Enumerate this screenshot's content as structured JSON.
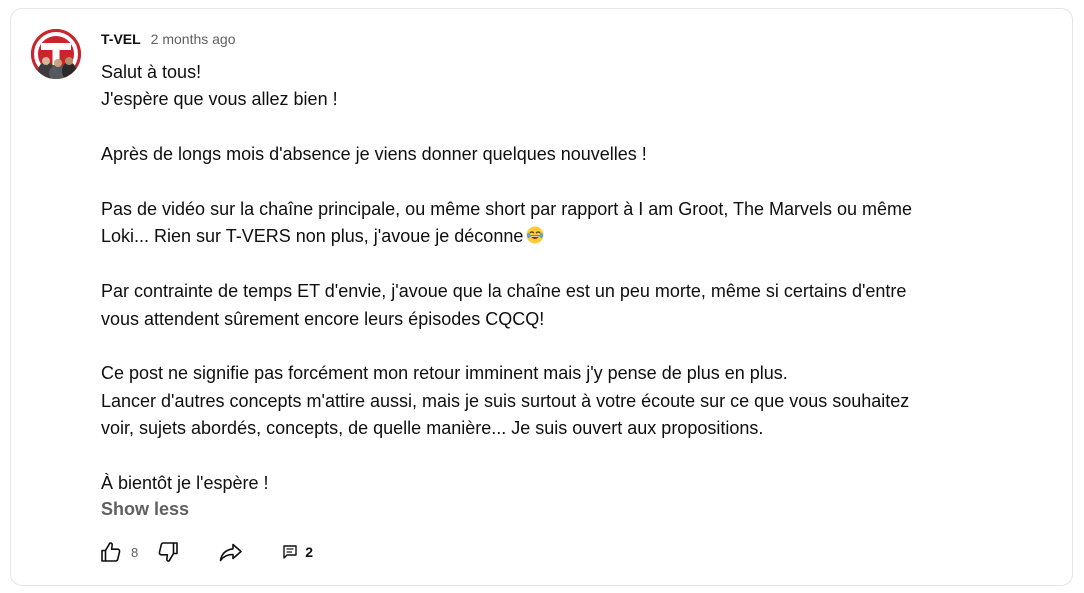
{
  "post": {
    "author": "T-VEL",
    "timestamp": "2 months ago",
    "paragraphs": [
      [
        "Salut à tous!",
        "J'espère que vous allez bien !"
      ],
      [
        "Après de longs mois d'absence je viens donner quelques nouvelles !"
      ],
      [
        "Pas de vidéo sur la chaîne principale, ou même short par rapport à I am Groot, The Marvels ou même",
        "Loki... Rien sur T-VERS non plus, j'avoue je déconne"
      ],
      [
        "Par contrainte de temps ET d'envie, j'avoue que la chaîne est un peu morte, même si certains d'entre",
        "vous attendent sûrement encore leurs épisodes CQCQ!"
      ],
      [
        "Ce post ne signifie pas forcément mon retour imminent mais j'y pense de plus en plus.",
        "Lancer d'autres concepts m'attire aussi, mais je suis surtout à votre écoute sur ce que vous souhaitez",
        "voir, sujets abordés, concepts, de quelle manière... Je suis ouvert aux propositions."
      ],
      [
        "À bientôt je l'espère !"
      ]
    ],
    "emoji": "laughing-with-tears-emoji",
    "show_less_label": "Show less"
  },
  "actions": {
    "like_icon": "thumbs-up-icon",
    "like_count": "8",
    "dislike_icon": "thumbs-down-icon",
    "share_icon": "share-icon",
    "reply_icon": "comment-icon",
    "reply_count": "2"
  },
  "colors": {
    "avatar_brand": "#c8252c",
    "secondary_text": "#606060",
    "primary_text": "#0f0f0f",
    "card_border": "#e5e5e5"
  }
}
